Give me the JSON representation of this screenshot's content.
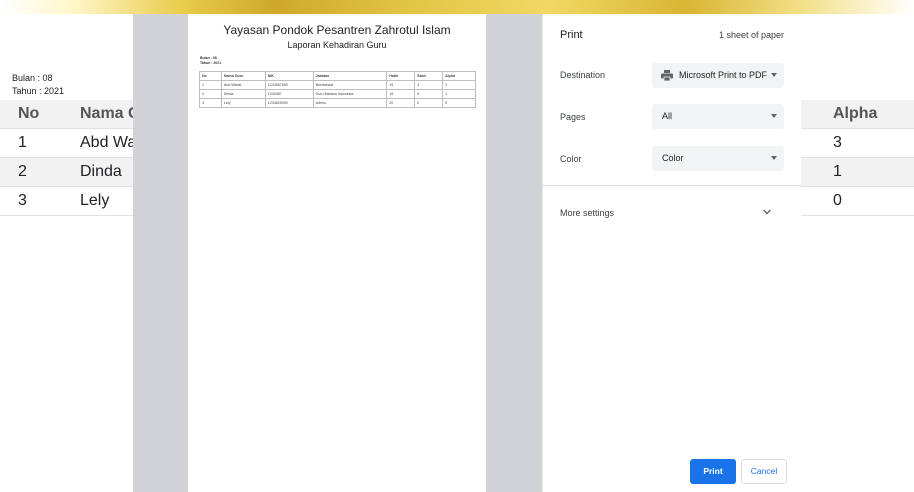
{
  "background": {
    "bulan": "Bulan : 08",
    "tahun": "Tahun : 2021",
    "headers": {
      "no": "No",
      "nama": "Nama Guru",
      "alpha": "Alpha"
    },
    "rows": [
      {
        "no": "1",
        "nama": "Abd Wahid",
        "alpha": "3"
      },
      {
        "no": "2",
        "nama": "Dinda",
        "alpha": "1"
      },
      {
        "no": "3",
        "nama": "Lely",
        "alpha": "0"
      }
    ]
  },
  "preview": {
    "title": "Yayasan Pondok Pesantren Zahrotul Islam",
    "subtitle": "Laporan Kehadiran Guru",
    "bulan": "Bulan : 08",
    "tahun": "Tahun : 2021",
    "headers": [
      "No",
      "Nama Guru",
      "NIK",
      "Jabatan",
      "Hadir",
      "Sakit",
      "Alpha"
    ],
    "rows": [
      [
        "1",
        "Abd Wahid",
        "1234567890",
        "Bendahara",
        "19",
        "3",
        "3"
      ],
      [
        "2",
        "Dinda",
        "1230987",
        "Guru Bahasa Indonesia",
        "15",
        "5",
        "1"
      ],
      [
        "3",
        "Lely",
        "1234629099",
        "Admin",
        "20",
        "0",
        "0"
      ]
    ]
  },
  "print_panel": {
    "title": "Print",
    "sheet_count": "1 sheet of paper",
    "destination_label": "Destination",
    "destination_value": "Microsoft Print to PDF",
    "pages_label": "Pages",
    "pages_value": "All",
    "color_label": "Color",
    "color_value": "Color",
    "more_settings": "More settings",
    "print_button": "Print",
    "cancel_button": "Cancel",
    "accent_color": "#1a73e8"
  }
}
